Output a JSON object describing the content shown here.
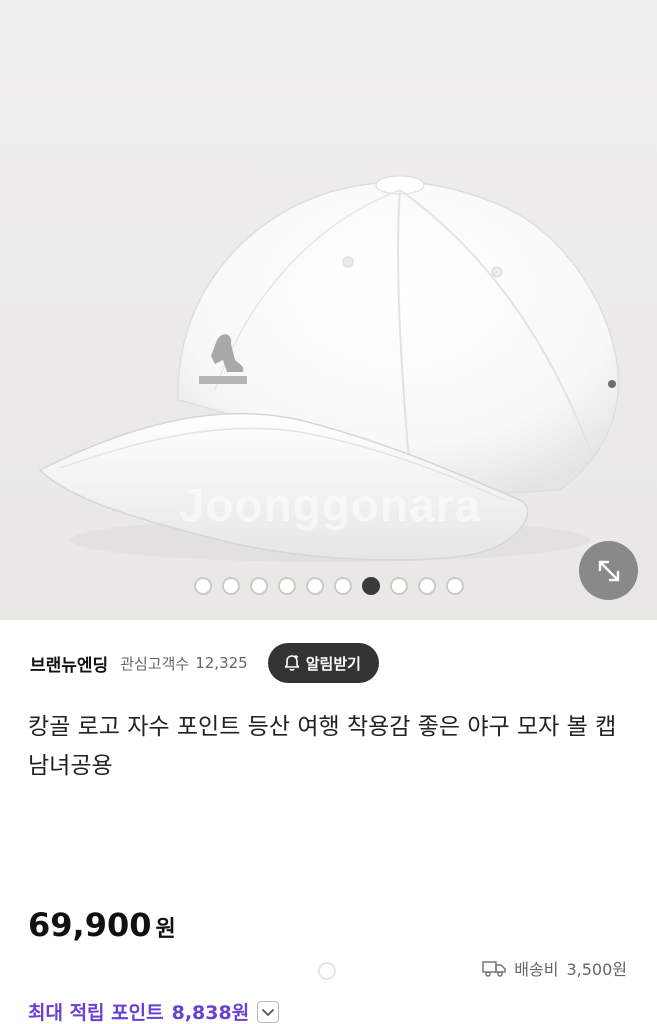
{
  "gallery": {
    "watermark": "Joonggonara",
    "dots": [
      false,
      false,
      false,
      false,
      false,
      false,
      true,
      false,
      false,
      false
    ]
  },
  "seller": {
    "name": "브랜뉴엔딩",
    "followers_label": "관심고객수",
    "followers_count": "12,325",
    "alarm_label": "알림받기"
  },
  "product": {
    "title": "캉골 로고 자수 포인트 등산 여행 착용감 좋은 야구 모자 볼 캡 남녀공용",
    "price": "69,900",
    "currency": "원"
  },
  "shipping": {
    "label": "배송비",
    "value": "3,500원"
  },
  "points": {
    "label": "최대 적립 포인트",
    "value": "8,838원"
  },
  "colors": {
    "accent_purple": "#6a3fd6",
    "alarm_button": "#333333"
  }
}
